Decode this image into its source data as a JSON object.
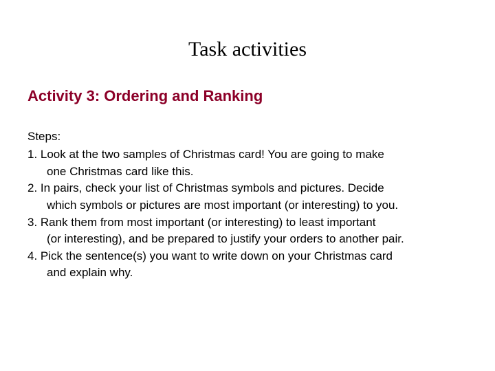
{
  "title": "Task activities",
  "activity_heading": "Activity 3: Ordering and Ranking",
  "steps_label": "Steps:",
  "steps": {
    "s1a": "1. Look at the two samples of Christmas card!  You are going to make",
    "s1b": "one Christmas card like this.",
    "s2a": "2. In pairs, check your list of Christmas symbols and pictures.   Decide",
    "s2b": "which symbols or pictures are most important (or interesting) to you.",
    "s3a": "3. Rank them from most important (or interesting) to least important",
    "s3b": "(or interesting), and be prepared to justify your orders to another pair.",
    "s4a": "4. Pick the sentence(s) you want to write down on your Christmas card",
    "s4b": "and explain why."
  }
}
